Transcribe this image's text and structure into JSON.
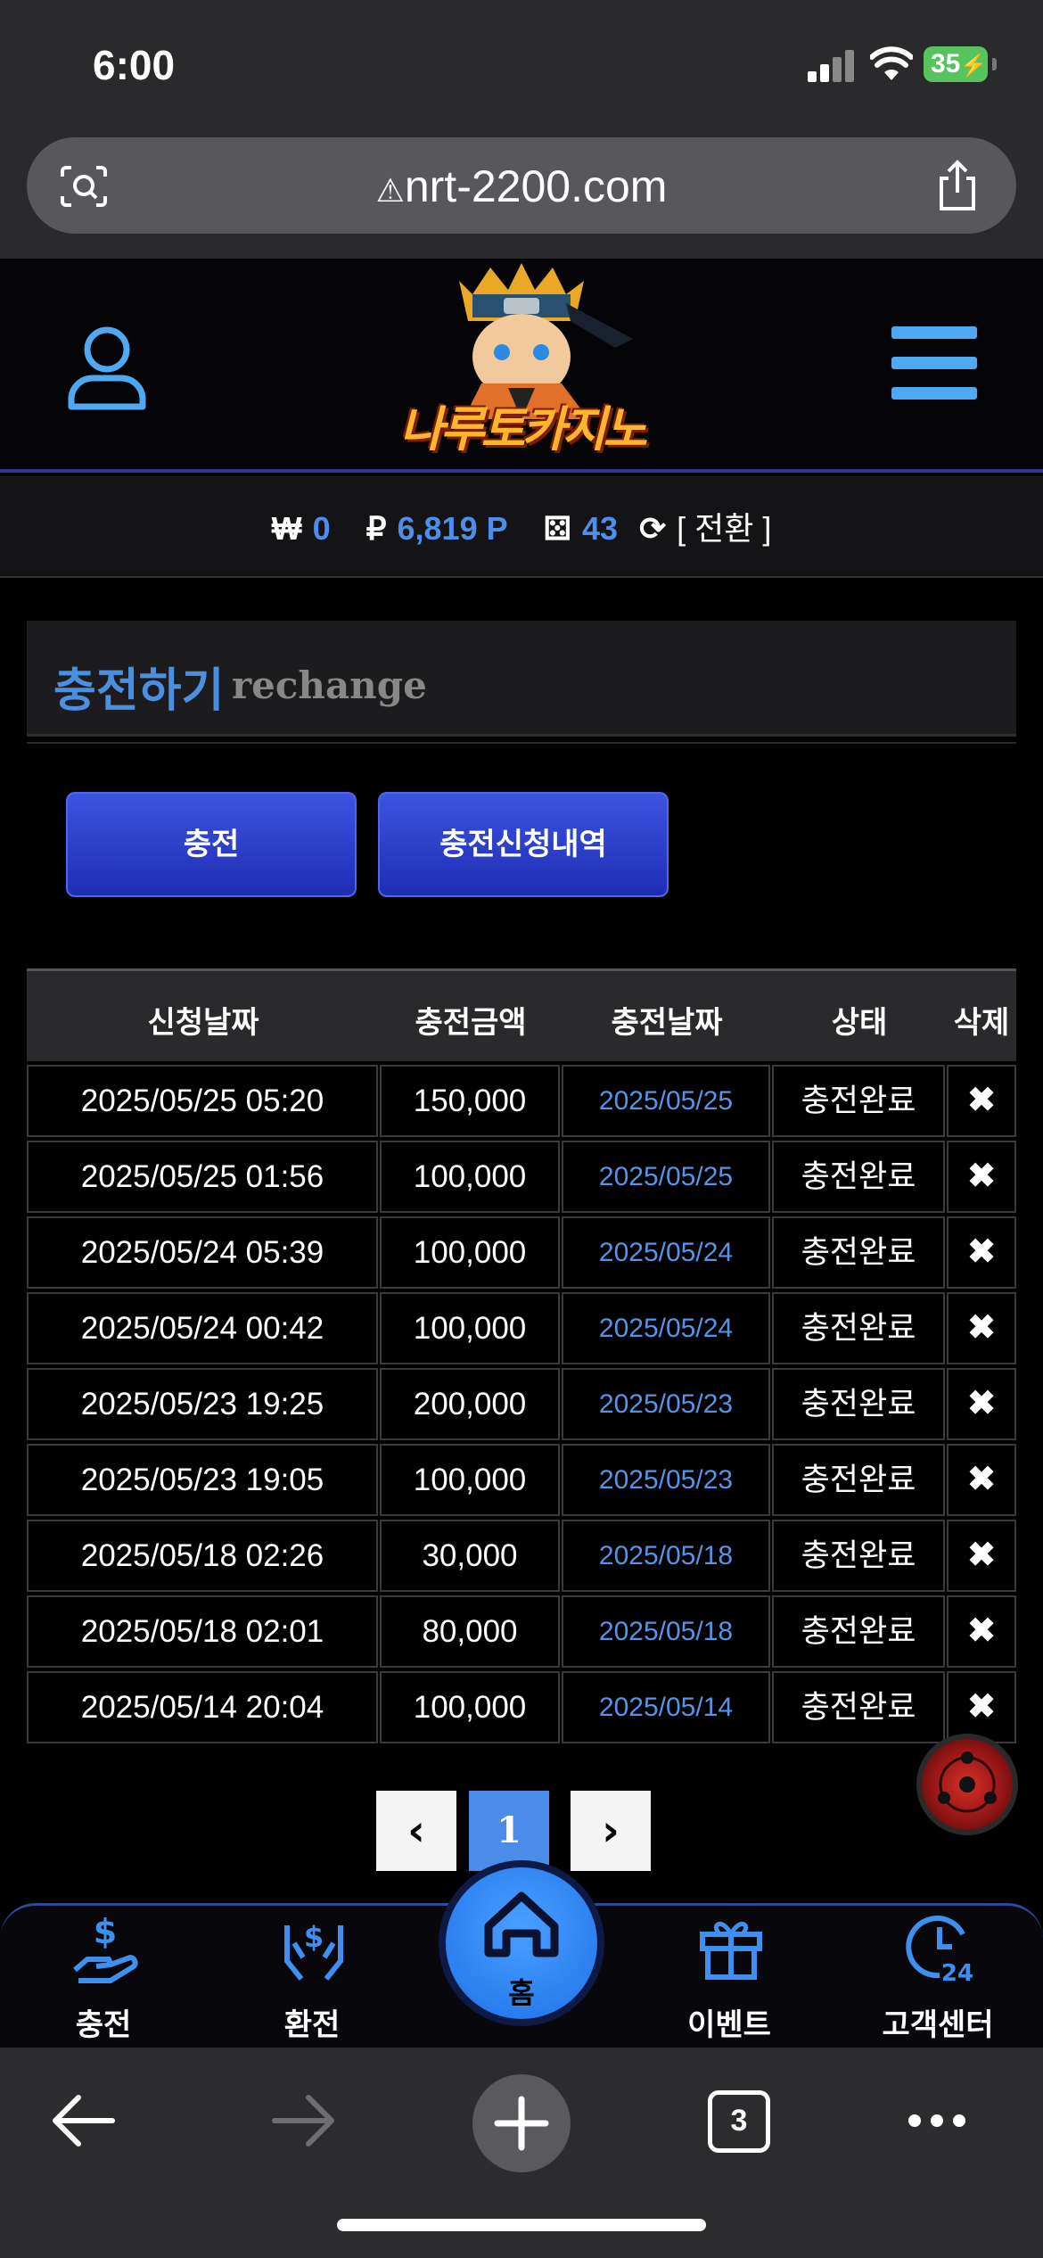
{
  "status_bar": {
    "time": "6:00",
    "battery": "35"
  },
  "browser": {
    "url": "nrt-2200.com",
    "tab_count": "3"
  },
  "site": {
    "logo_text": "나루토카지노",
    "balance": {
      "won_symbol": "₩",
      "won_value": "0",
      "point_symbol": "₽",
      "point_value": "6,819 P",
      "dice_value": "43",
      "switch_label": "[ 전환 ]"
    }
  },
  "section": {
    "title_kr": "충전하기",
    "title_en": "rechange"
  },
  "buttons": {
    "charge": "충전",
    "charge_history": "충전신청내역"
  },
  "table": {
    "headers": [
      "신청날짜",
      "충전금액",
      "충전날짜",
      "상태",
      "삭제"
    ],
    "rows": [
      {
        "request_date": "2025/05/25 05:20",
        "amount": "150,000",
        "charge_date": "2025/05/25",
        "status": "충전완료",
        "delete": "✖"
      },
      {
        "request_date": "2025/05/25 01:56",
        "amount": "100,000",
        "charge_date": "2025/05/25",
        "status": "충전완료",
        "delete": "✖"
      },
      {
        "request_date": "2025/05/24 05:39",
        "amount": "100,000",
        "charge_date": "2025/05/24",
        "status": "충전완료",
        "delete": "✖"
      },
      {
        "request_date": "2025/05/24 00:42",
        "amount": "100,000",
        "charge_date": "2025/05/24",
        "status": "충전완료",
        "delete": "✖"
      },
      {
        "request_date": "2025/05/23 19:25",
        "amount": "200,000",
        "charge_date": "2025/05/23",
        "status": "충전완료",
        "delete": "✖"
      },
      {
        "request_date": "2025/05/23 19:05",
        "amount": "100,000",
        "charge_date": "2025/05/23",
        "status": "충전완료",
        "delete": "✖"
      },
      {
        "request_date": "2025/05/18 02:26",
        "amount": "30,000",
        "charge_date": "2025/05/18",
        "status": "충전완료",
        "delete": "✖"
      },
      {
        "request_date": "2025/05/18 02:01",
        "amount": "80,000",
        "charge_date": "2025/05/18",
        "status": "충전완료",
        "delete": "✖"
      },
      {
        "request_date": "2025/05/14 20:04",
        "amount": "100,000",
        "charge_date": "2025/05/14",
        "status": "충전완료",
        "delete": "✖"
      }
    ]
  },
  "pagination": {
    "prev": "‹",
    "current": "1",
    "next": "›"
  },
  "bottom_nav": {
    "charge": "충전",
    "exchange": "환전",
    "home": "홈",
    "event": "이벤트",
    "support": "고객센터"
  },
  "colors": {
    "accent": "#4a8fe0",
    "button": "#2a3ccc",
    "date_blue": "#5594e6"
  }
}
